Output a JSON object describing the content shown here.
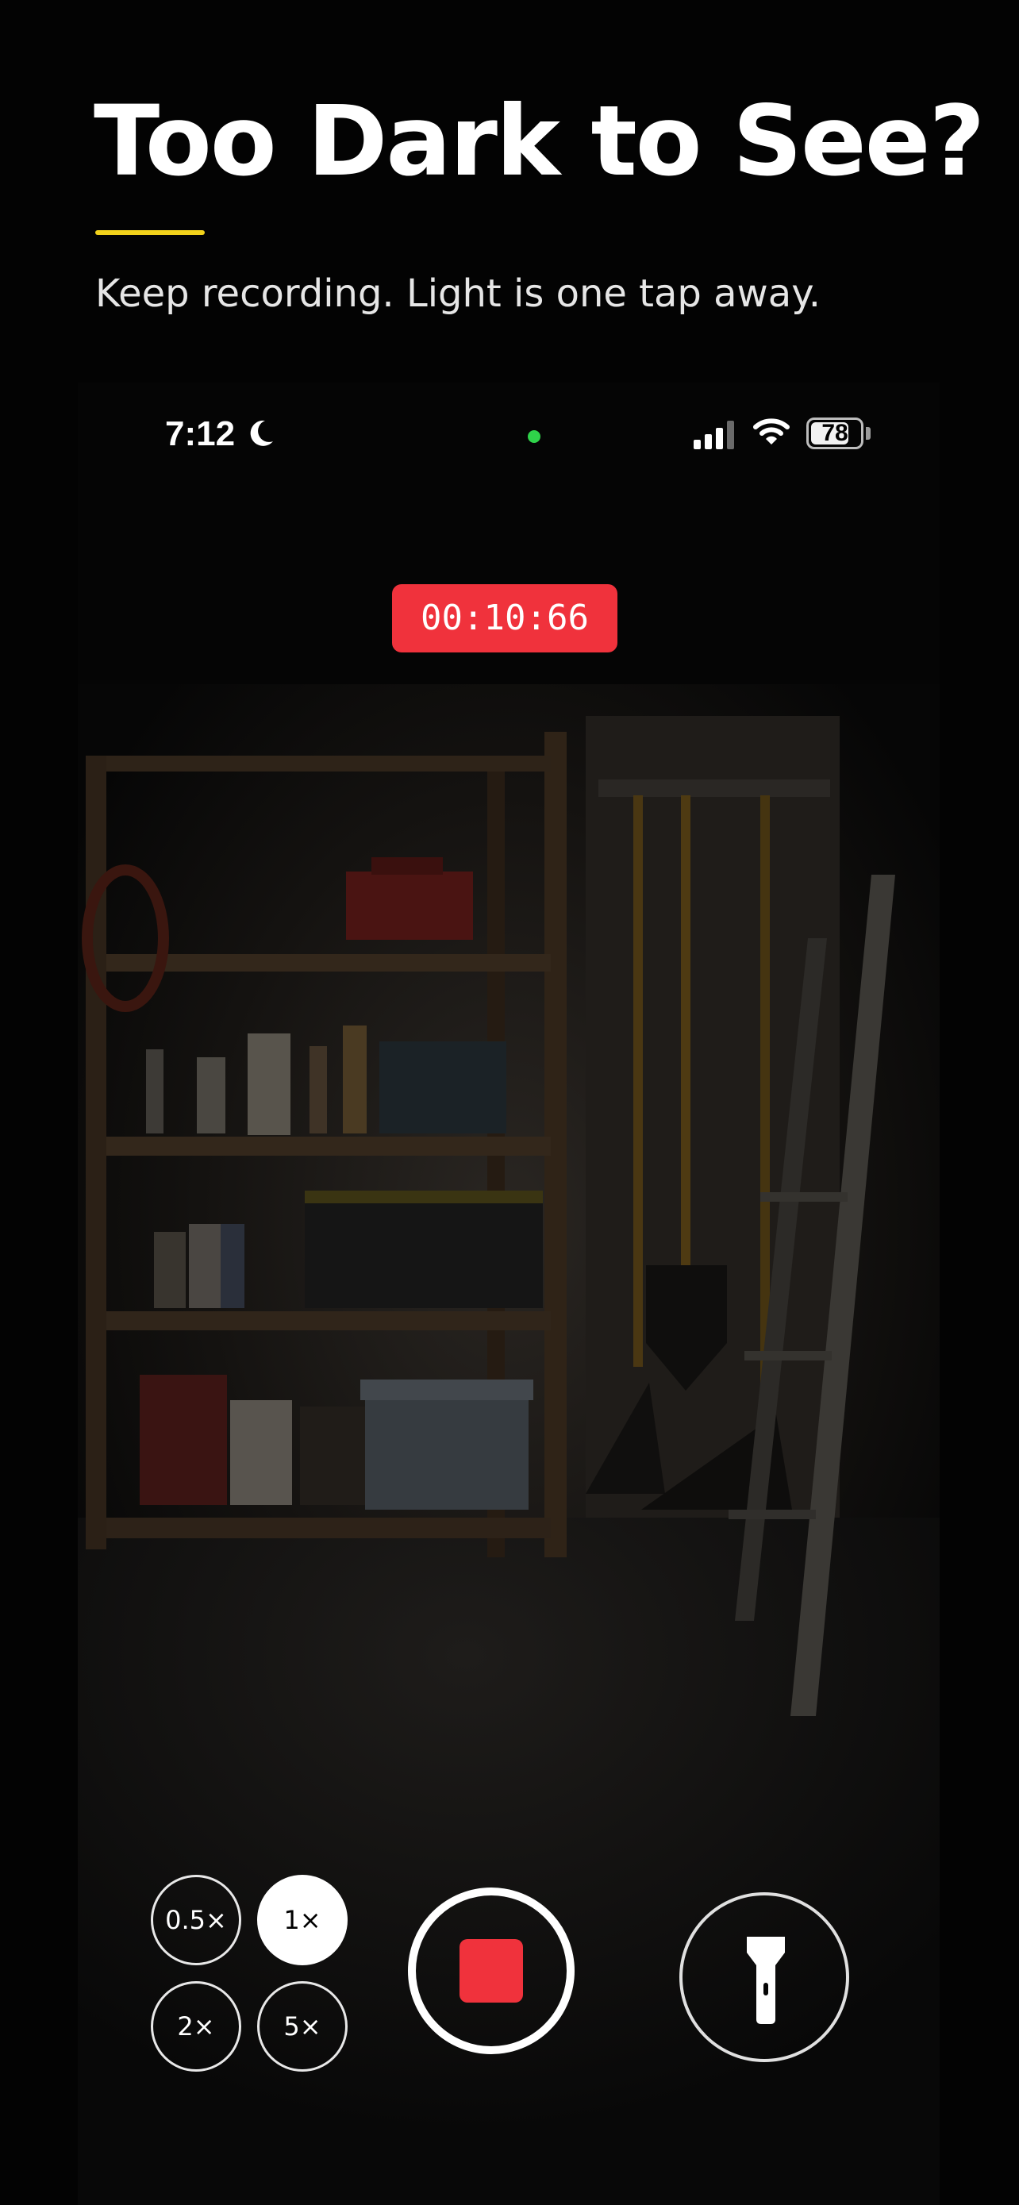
{
  "header": {
    "title": "Too Dark to See?",
    "subtitle": "Keep recording. Light is one tap away.",
    "accent_color": "#f2d21b"
  },
  "status_bar": {
    "time": "7:12",
    "focus_icon": "moon-icon",
    "camera_indicator_color": "#2fd24a",
    "signal_icon": "cellular-signal-icon",
    "wifi_icon": "wifi-icon",
    "battery_level": "78",
    "battery_fraction": 0.78
  },
  "recording": {
    "timer": "00:10:66",
    "color": "#f0323c"
  },
  "zoom_options": [
    {
      "label": "0.5×",
      "active": false
    },
    {
      "label": "1×",
      "active": true
    },
    {
      "label": "2×",
      "active": false
    },
    {
      "label": "5×",
      "active": false
    }
  ],
  "controls": {
    "record_icon": "stop-square-icon",
    "flashlight_icon": "flashlight-icon"
  }
}
